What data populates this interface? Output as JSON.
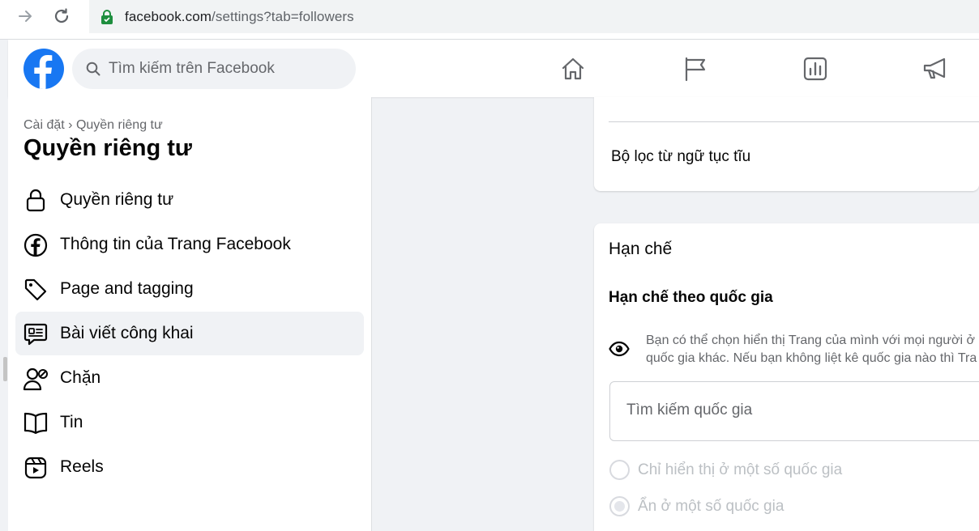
{
  "browser": {
    "url_host": "facebook.com",
    "url_path": "/settings?tab=followers"
  },
  "header": {
    "search_placeholder": "Tìm kiếm trên Facebook",
    "nav_icons": [
      "home-icon",
      "flag-icon",
      "insights-icon",
      "megaphone-icon"
    ]
  },
  "sidebar": {
    "breadcrumb_root": "Cài đặt",
    "breadcrumb_separator": "›",
    "breadcrumb_current": "Quyền riêng tư",
    "title": "Quyền riêng tư",
    "items": [
      {
        "label": "Quyền riêng tư",
        "icon": "lock-icon",
        "active": false
      },
      {
        "label": "Thông tin của Trang Facebook",
        "icon": "facebook-icon",
        "active": false
      },
      {
        "label": "Page and tagging",
        "icon": "tag-icon",
        "active": false
      },
      {
        "label": "Bài viết công khai",
        "icon": "public-post-icon",
        "active": true
      },
      {
        "label": "Chặn",
        "icon": "block-user-icon",
        "active": false
      },
      {
        "label": "Tin",
        "icon": "story-book-icon",
        "active": false
      },
      {
        "label": "Reels",
        "icon": "reels-icon",
        "active": false
      }
    ]
  },
  "content": {
    "profanity_filter_label": "Bộ lọc từ ngữ tục tĩu",
    "restrictions": {
      "title": "Hạn chế",
      "country_restriction_title": "Hạn chế theo quốc gia",
      "info_line1": "Bạn có thể chọn hiển thị Trang của mình với mọi người ở",
      "info_line2": "quốc gia khác. Nếu bạn không liệt kê quốc gia nào thì Tra",
      "country_search_placeholder": "Tìm kiếm quốc gia",
      "options": [
        {
          "label": "Chỉ hiển thị ở một số quốc gia",
          "checked": false
        },
        {
          "label": "Ẩn ở một số quốc gia",
          "checked": true
        }
      ]
    }
  },
  "colors": {
    "brand_blue": "#1877f2",
    "background": "#f0f2f5",
    "secure_lock": "#1e8e3e"
  }
}
